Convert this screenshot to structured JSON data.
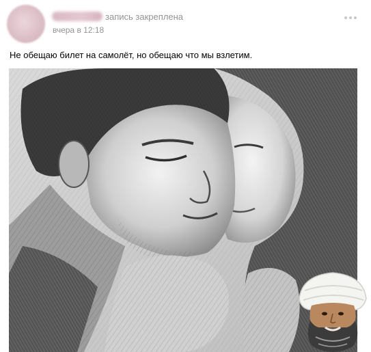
{
  "post": {
    "author_name_hidden": "",
    "pinned_label": "запись закреплена",
    "timestamp": "вчера в 12:18",
    "text": "Не обещаю билет на самолёт, но обещаю что мы взлетим.",
    "more_icon": "more-horizontal-icon"
  },
  "media": {
    "photo_icon": "pencil-drawing-image",
    "sticker_icon": "bearded-man-sticker"
  },
  "colors": {
    "meta_text": "#939393",
    "avatar_blur": "#dcbfc6",
    "background": "#ffffff"
  }
}
